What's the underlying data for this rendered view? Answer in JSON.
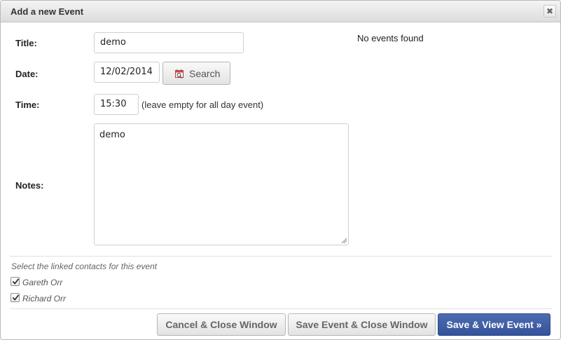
{
  "dialog": {
    "title": "Add a new Event",
    "close_glyph": "✖"
  },
  "form": {
    "title_label": "Title:",
    "title_value": "demo",
    "date_label": "Date:",
    "date_value": "12/02/2014",
    "search_label": "Search",
    "search_icon": "calendar-search-icon",
    "time_label": "Time:",
    "time_value": "15:30",
    "time_hint": "(leave empty for all day event)",
    "notes_label": "Notes:",
    "notes_value": "demo"
  },
  "events_panel": {
    "empty_text": "No events found"
  },
  "contacts": {
    "caption": "Select the linked contacts for this event",
    "items": [
      {
        "name": "Gareth Orr",
        "checked": true
      },
      {
        "name": "Richard Orr",
        "checked": true
      }
    ]
  },
  "footer": {
    "cancel_label": "Cancel & Close Window",
    "save_close_label": "Save Event & Close Window",
    "save_view_label": "Save & View Event »"
  },
  "colors": {
    "primary_button": "#3a5aa2",
    "title_bar": "#e4e4e4"
  }
}
